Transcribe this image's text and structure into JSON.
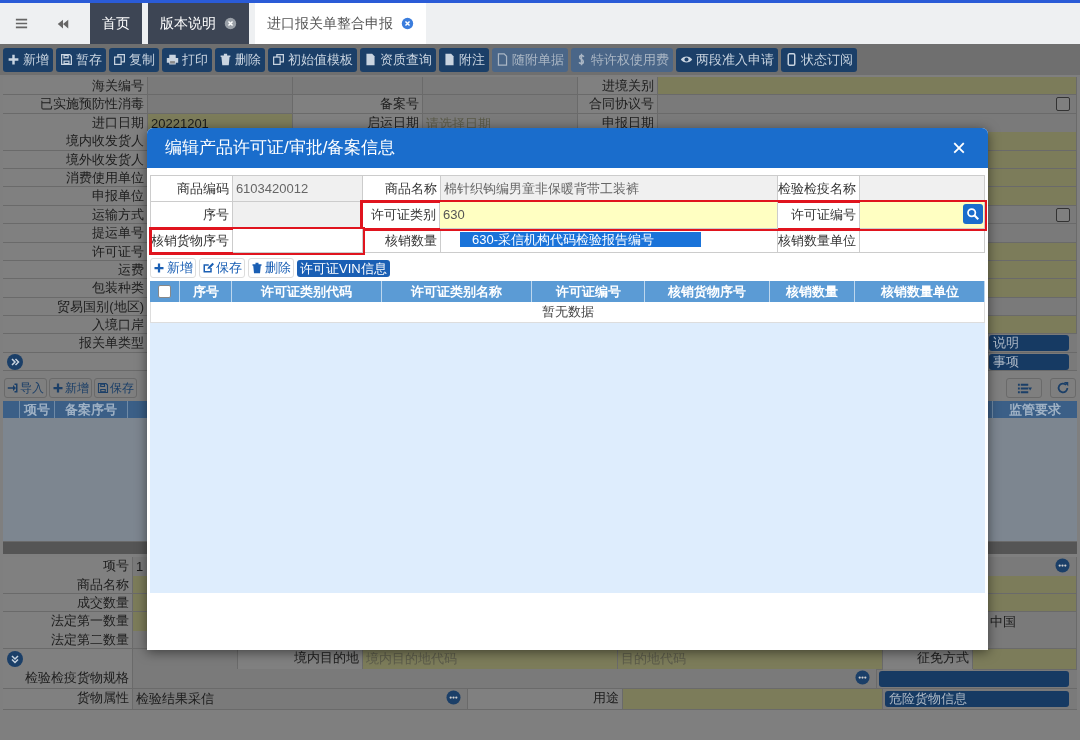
{
  "tabs": [
    {
      "label": "首页",
      "selected": false,
      "closable": false
    },
    {
      "label": "版本说明",
      "selected": false,
      "closable": true
    },
    {
      "label": "进口报关单整合申报",
      "selected": true,
      "closable": true
    }
  ],
  "toolbar": [
    {
      "label": "新增",
      "kind": "plus",
      "disabled": false
    },
    {
      "label": "暂存",
      "kind": "save",
      "disabled": false
    },
    {
      "label": "复制",
      "kind": "copy",
      "disabled": false
    },
    {
      "label": "打印",
      "kind": "print",
      "disabled": false
    },
    {
      "label": "删除",
      "kind": "trash",
      "disabled": false
    },
    {
      "label": "初始值模板",
      "kind": "copy",
      "disabled": false
    },
    {
      "label": "资质查询",
      "kind": "doc",
      "disabled": false
    },
    {
      "label": "附注",
      "kind": "doc",
      "disabled": false
    },
    {
      "label": "随附单据",
      "kind": "pdf",
      "disabled": true
    },
    {
      "label": "特许权使用费",
      "kind": "dollar",
      "disabled": true
    },
    {
      "label": "两段准入申请",
      "kind": "eye",
      "disabled": false
    },
    {
      "label": "状态订阅",
      "kind": "phone",
      "disabled": false
    }
  ],
  "header_form": [
    {
      "kind": "quad",
      "cells": [
        {
          "kind": "label",
          "text": "海关编号"
        },
        {
          "kind": "field",
          "required": false
        },
        {
          "kind": "field",
          "required": false
        },
        {
          "kind": "field",
          "required": false
        },
        {
          "kind": "label",
          "text": "进境关别"
        },
        {
          "kind": "field",
          "required": true
        }
      ]
    },
    {
      "kind": "quad",
      "cells": [
        {
          "kind": "label",
          "text": "已实施预防性消毒"
        },
        {
          "kind": "field",
          "required": false
        },
        {
          "kind": "label",
          "text": "备案号"
        },
        {
          "kind": "field",
          "required": false
        },
        {
          "kind": "label",
          "text": "合同协议号"
        },
        {
          "kind": "checkfield",
          "required": false,
          "checked": false
        }
      ]
    },
    {
      "kind": "quad",
      "cells": [
        {
          "kind": "label",
          "text": "进口日期"
        },
        {
          "kind": "field",
          "required": true,
          "value": "20221201"
        },
        {
          "kind": "label",
          "text": "启运日期"
        },
        {
          "kind": "field",
          "required": false,
          "placeholder": "请选择日期"
        },
        {
          "kind": "label",
          "text": "申报日期"
        },
        {
          "kind": "field",
          "required": false
        }
      ]
    },
    {
      "kind": "wide",
      "cells": [
        {
          "kind": "label",
          "text": "境内收发货人"
        },
        {
          "kind": "field",
          "required": true
        }
      ]
    },
    {
      "kind": "wide",
      "cells": [
        {
          "kind": "label",
          "text": "境外收发货人"
        },
        {
          "kind": "field",
          "required": true
        }
      ]
    },
    {
      "kind": "wide",
      "cells": [
        {
          "kind": "label",
          "text": "消费使用单位"
        },
        {
          "kind": "field",
          "required": true
        }
      ]
    },
    {
      "kind": "wide",
      "cells": [
        {
          "kind": "label",
          "text": "申报单位"
        },
        {
          "kind": "field",
          "required": true
        }
      ]
    },
    {
      "kind": "wide",
      "cells": [
        {
          "kind": "label",
          "text": "运输方式"
        },
        {
          "kind": "checkfield",
          "required": false,
          "checked": false
        }
      ]
    },
    {
      "kind": "wide",
      "cells": [
        {
          "kind": "label",
          "text": "提运单号"
        },
        {
          "kind": "field",
          "required": false
        }
      ]
    },
    {
      "kind": "wide",
      "cells": [
        {
          "kind": "label",
          "text": "许可证号"
        },
        {
          "kind": "field",
          "required": true
        }
      ]
    },
    {
      "kind": "wide",
      "cells": [
        {
          "kind": "label",
          "text": "运费"
        },
        {
          "kind": "field",
          "required": true
        }
      ]
    },
    {
      "kind": "wide",
      "cells": [
        {
          "kind": "label",
          "text": "包装种类"
        },
        {
          "kind": "field",
          "required": true
        }
      ]
    },
    {
      "kind": "wide",
      "cells": [
        {
          "kind": "label",
          "text": "贸易国别(地区)"
        },
        {
          "kind": "field",
          "required": false
        }
      ]
    },
    {
      "kind": "wide",
      "cells": [
        {
          "kind": "label",
          "text": "入境口岸"
        },
        {
          "kind": "field",
          "required": true
        }
      ]
    },
    {
      "kind": "wide_btn",
      "cells": [
        {
          "kind": "label",
          "text": "报关单类型"
        },
        {
          "kind": "spacer"
        },
        {
          "kind": "button",
          "label": "说明"
        }
      ]
    },
    {
      "kind": "wide_btn",
      "cells": [
        {
          "kind": "toggle",
          "expanded": false
        },
        {
          "kind": "spacer"
        },
        {
          "kind": "button",
          "label": "事项"
        }
      ]
    }
  ],
  "items_toolbar": [
    {
      "label": "导入",
      "kind": "import"
    },
    {
      "label": "新增",
      "kind": "plus"
    },
    {
      "label": "保存",
      "kind": "save"
    }
  ],
  "items_table": {
    "columns": [
      "项号",
      "备案序号"
    ],
    "right_column": "监管要求"
  },
  "item_form": [
    {
      "kind": "wide",
      "cells": [
        {
          "kind": "label",
          "text": "项号"
        },
        {
          "kind": "field",
          "required": false,
          "value": "1",
          "more": true
        }
      ]
    },
    {
      "kind": "wide",
      "cells": [
        {
          "kind": "label",
          "text": "商品名称"
        },
        {
          "kind": "field",
          "required": true
        }
      ]
    },
    {
      "kind": "wide",
      "cells": [
        {
          "kind": "label",
          "text": "成交数量"
        },
        {
          "kind": "field",
          "required": true
        }
      ]
    },
    {
      "kind": "wide_btn",
      "cells": [
        {
          "kind": "label",
          "text": "法定第一数量"
        },
        {
          "kind": "field",
          "required": true
        },
        {
          "kind": "field",
          "required": false,
          "value": "中国"
        }
      ]
    },
    {
      "kind": "wide",
      "cells": [
        {
          "kind": "label",
          "text": "法定第二数量"
        },
        {
          "kind": "field",
          "required": false
        }
      ]
    },
    {
      "kind": "dest",
      "cells": [
        {
          "kind": "toggle",
          "expanded": true
        },
        {
          "kind": "blank"
        },
        {
          "kind": "label",
          "text": "境内目的地"
        },
        {
          "kind": "field",
          "required": true,
          "placeholder": "境内目的地代码"
        },
        {
          "kind": "field",
          "required": true,
          "placeholder": "目的地代码"
        },
        {
          "kind": "label",
          "text": "征免方式"
        },
        {
          "kind": "field",
          "required": true
        }
      ]
    },
    {
      "kind": "spec",
      "cells": [
        {
          "kind": "label",
          "text": "检验检疫货物规格"
        },
        {
          "kind": "field",
          "required": false,
          "more": true
        },
        {
          "kind": "button"
        }
      ]
    },
    {
      "kind": "attr",
      "cells": [
        {
          "kind": "label",
          "text": "货物属性"
        },
        {
          "kind": "field",
          "required": false,
          "value": "检验结果采信",
          "more": true
        },
        {
          "kind": "label",
          "text": "用途"
        },
        {
          "kind": "field",
          "required": true
        },
        {
          "kind": "button",
          "label": "危险货物信息"
        }
      ]
    }
  ],
  "dialog": {
    "title": "编辑产品许可证/审批/备案信息",
    "close": "×",
    "rows": [
      [
        {
          "label": "商品编码",
          "value": "6103420012",
          "readonly": true,
          "highlighted": false
        },
        {
          "label": "商品名称",
          "value": "棉针织钩编男童非保暖背带工装裤",
          "readonly": true,
          "highlighted": false
        },
        {
          "label": "检验检疫名称",
          "readonly": true,
          "highlighted": false
        }
      ],
      [
        {
          "label": "序号",
          "readonly": true,
          "highlighted": false
        },
        {
          "label": "许可证类别",
          "value": "630",
          "readonly": false,
          "required": true,
          "highlighted": true
        },
        {
          "label": "许可证编号",
          "readonly": false,
          "required": true,
          "search": true,
          "highlighted": true
        }
      ],
      [
        {
          "label": "核销货物序号",
          "readonly": false,
          "required": false,
          "highlighted": true
        },
        {
          "label": "核销数量",
          "readonly": false,
          "required": false,
          "highlighted": false
        },
        {
          "label": "核销数量单位",
          "readonly": false,
          "required": false,
          "highlighted": false
        }
      ]
    ],
    "suggestion": {
      "text": "630-采信机构代码检验报告编号",
      "selected": true
    },
    "toolbar": [
      {
        "label": "新增",
        "kind": "plus"
      },
      {
        "label": "保存",
        "kind": "edit"
      },
      {
        "label": "删除",
        "kind": "trash"
      },
      {
        "label": "许可证VIN信息",
        "kind": "primary"
      }
    ],
    "table": {
      "select_all": {
        "checked": false
      },
      "columns": [
        "序号",
        "许可证类别代码",
        "许可证类别名称",
        "许可证编号",
        "核销货物序号",
        "核销数量",
        "核销数量单位"
      ],
      "empty_text": "暂无数据"
    }
  }
}
